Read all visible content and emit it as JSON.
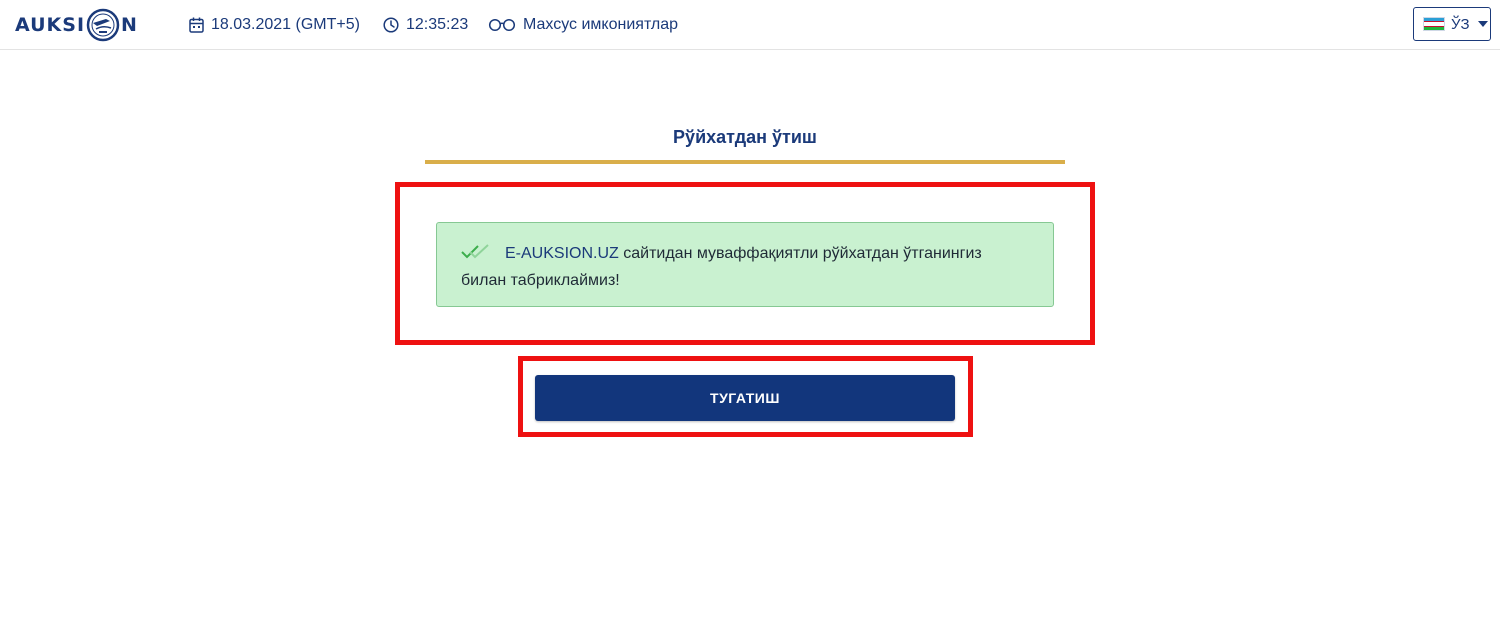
{
  "header": {
    "logo_left": "AUKSI",
    "logo_right": "N",
    "date": "18.03.2021 (GMT+5)",
    "time": "12:35:23",
    "accessibility": "Махсус имкониятлар",
    "language": "ЎЗ"
  },
  "page": {
    "title": "Рўйхатдан ўтиш"
  },
  "alert": {
    "site": "E-AUKSION.UZ",
    "message_line1": " сайтидан муваффақиятли рўйхатдан ўтганингиз",
    "message_line2": "билан табриклаймиз!"
  },
  "finish_button": {
    "label": "ТУГАТИШ"
  },
  "colors": {
    "brand": "#1b3a7a",
    "button": "#12367c",
    "rule": "#d9ae4a",
    "alert_bg": "#c9f1d0",
    "highlight": "#ee1111"
  },
  "icons": {
    "date": "calendar-icon",
    "time": "clock-icon",
    "accessibility": "glasses-icon",
    "alert": "double-check-icon",
    "language": "uzbekistan-flag-icon"
  }
}
